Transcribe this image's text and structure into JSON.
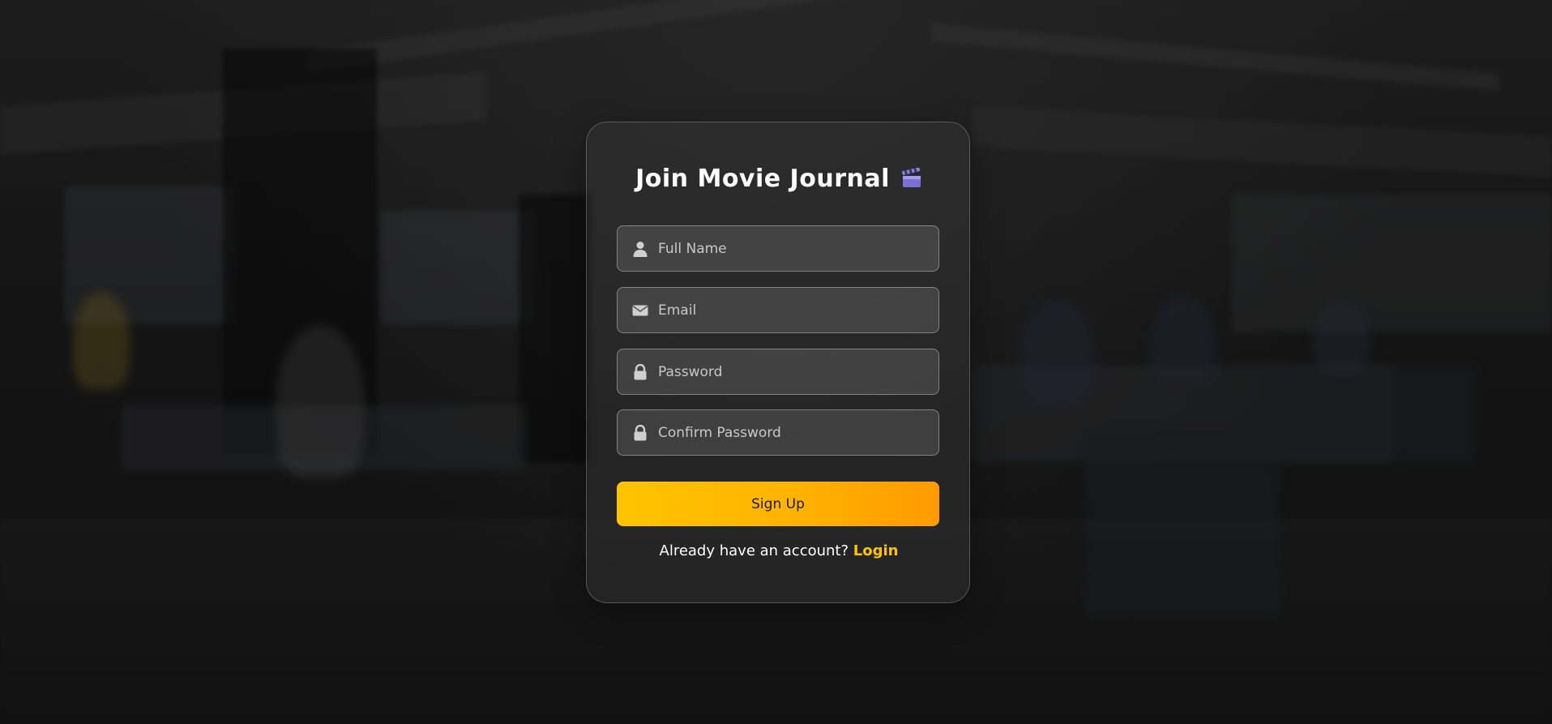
{
  "page": {
    "title": "Join Movie Journal",
    "title_icon": "clapperboard-icon"
  },
  "form": {
    "fields": [
      {
        "placeholder": "Full Name",
        "value": "",
        "icon": "user-icon"
      },
      {
        "placeholder": "Email",
        "value": "",
        "icon": "envelope-icon"
      },
      {
        "placeholder": "Password",
        "value": "",
        "icon": "lock-icon"
      },
      {
        "placeholder": "Confirm Password",
        "value": "",
        "icon": "lock-icon"
      }
    ],
    "submit_label": "Sign Up"
  },
  "footer": {
    "prompt": "Already have an account? ",
    "link_label": "Login"
  },
  "colors": {
    "accent": "#ffc400",
    "accent_end": "#ff9a00",
    "text": "#ffffff"
  }
}
